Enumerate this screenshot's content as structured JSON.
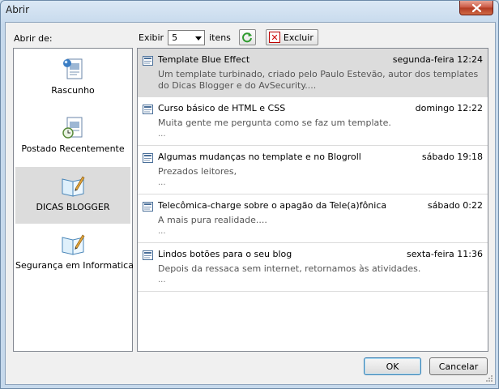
{
  "window": {
    "title": "Abrir"
  },
  "sidebar": {
    "label": "Abrir de:",
    "items": [
      {
        "label": "Rascunho",
        "icon": "draft-doc-icon"
      },
      {
        "label": "Postado Recentemente",
        "icon": "recent-clock-doc-icon"
      },
      {
        "label": "DICAS BLOGGER",
        "icon": "blog-book-icon",
        "selected": true
      },
      {
        "label": "Segurança em Informatica",
        "icon": "blog-book-icon"
      }
    ]
  },
  "toolbar": {
    "exibir_label": "Exibir",
    "count_value": "5",
    "itens_label": "itens",
    "delete_label": "Excluir"
  },
  "posts": [
    {
      "title": "Template Blue Effect",
      "date": "segunda-feira 12:24",
      "desc": "Um template turbinado, criado pelo Paulo Estevão, autor dos templates do Dicas Blogger e do AvSecurity....",
      "more": "",
      "selected": true
    },
    {
      "title": "Curso básico de HTML e CSS",
      "date": "domingo 12:22",
      "desc": "Muita gente me pergunta como se faz um template.",
      "more": "..."
    },
    {
      "title": "Algumas mudanças no template e no Blogroll",
      "date": "sábado 19:18",
      "desc": "Prezados leitores,",
      "more": "..."
    },
    {
      "title": "Telecômica-charge sobre o apagão da Tele(a)fônica",
      "date": "sábado 0:22",
      "desc": "A mais pura realidade....",
      "more": "..."
    },
    {
      "title": "Lindos botões para o seu blog",
      "date": "sexta-feira 11:36",
      "desc": "Depois da ressaca sem internet, retornamos às atividades.",
      "more": "..."
    }
  ],
  "buttons": {
    "ok": "OK",
    "cancel": "Cancelar"
  },
  "colors": {
    "selection": "#dcdcdc",
    "title_bar": "#c6d9ec",
    "close": "#c9553f"
  }
}
